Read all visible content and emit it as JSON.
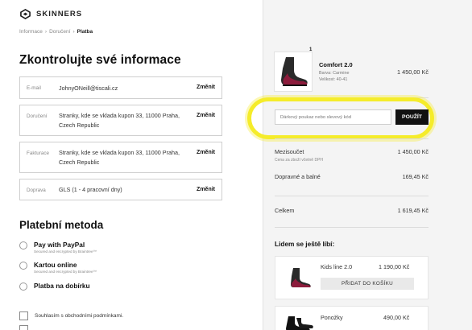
{
  "header": {
    "logo_text": "SKINNERS"
  },
  "breadcrumb": [
    "Informace",
    "Doručení",
    "Platba"
  ],
  "page_title": "Zkontrolujte své informace",
  "info": [
    {
      "label": "E-mail",
      "value": "JohnyONeill@tiscali.cz",
      "action": "Změnit"
    },
    {
      "label": "Doručení",
      "value": "Stranky, kde se vklada kupon 33, 11000 Praha, Czech Republic",
      "action": "Změnit"
    },
    {
      "label": "Fakturace",
      "value": "Stranky, kde se vklada kupon 33, 11000 Praha, Czech Republic",
      "action": "Změnit"
    },
    {
      "label": "Doprava",
      "value": "GLS (1 - 4 pracovní dny)",
      "action": "Změnit"
    }
  ],
  "payment": {
    "title": "Platební metoda",
    "options": [
      {
        "name": "Pay with PayPal",
        "sub": "Secured and encrypted by Braintree™"
      },
      {
        "name": "Kartou online",
        "sub": "Secured and encrypted by Braintree™"
      },
      {
        "name": "Platba na dobírku",
        "sub": ""
      }
    ]
  },
  "terms_label": "Souhlasím s obchodními podmínkami.",
  "cart": {
    "item": {
      "quantity": "1",
      "name": "Comfort 2.0",
      "color": "Barva: Carmine",
      "size": "Velikost: 40-41",
      "price": "1 450,00 Kč"
    },
    "coupon_placeholder": "Dárkový poukaz nebo slevový kód",
    "coupon_button": "POUŽÍT",
    "highlight_color": "#f5ec2a"
  },
  "summary": {
    "subtotal_label": "Mezisoučet",
    "subtotal_value": "1 450,00 Kč",
    "subtotal_note": "Cena za zboží včetně DPH",
    "shipping_label": "Dopravné a balné",
    "shipping_value": "169,45 Kč",
    "total_label": "Celkem",
    "total_value": "1 619,45 Kč"
  },
  "recommendations": {
    "title": "Lidem se ještě líbí:",
    "items": [
      {
        "name": "Kids line 2.0",
        "price": "1 190,00 Kč",
        "button": "PŘIDAT DO KOŠÍKU"
      },
      {
        "name": "Ponožky",
        "price": "490,00 Kč",
        "button": ""
      }
    ]
  },
  "colors": {
    "accent": "#111111",
    "panel_bg": "#f4f4f4",
    "product_red": "#8c1c3c"
  }
}
